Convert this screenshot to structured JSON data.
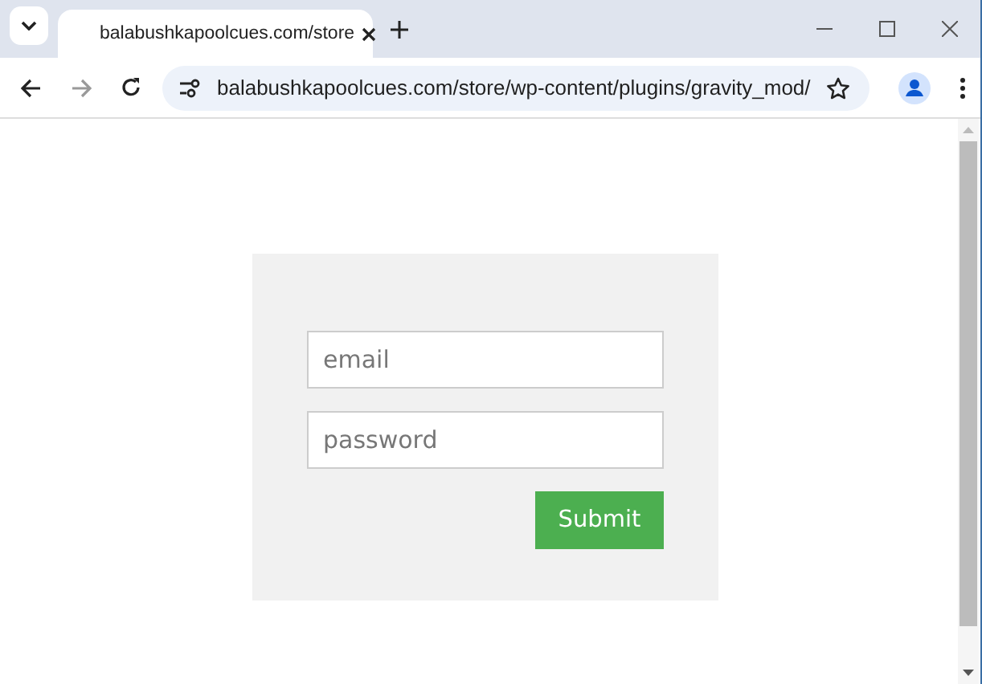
{
  "browser": {
    "tab_title": "balabushkapoolcues.com/store",
    "address": "balabushkapoolcues.com/store/wp-content/plugins/gravity_mod/"
  },
  "form": {
    "email": {
      "placeholder": "email"
    },
    "password": {
      "placeholder": "password"
    },
    "submit": "Submit"
  }
}
